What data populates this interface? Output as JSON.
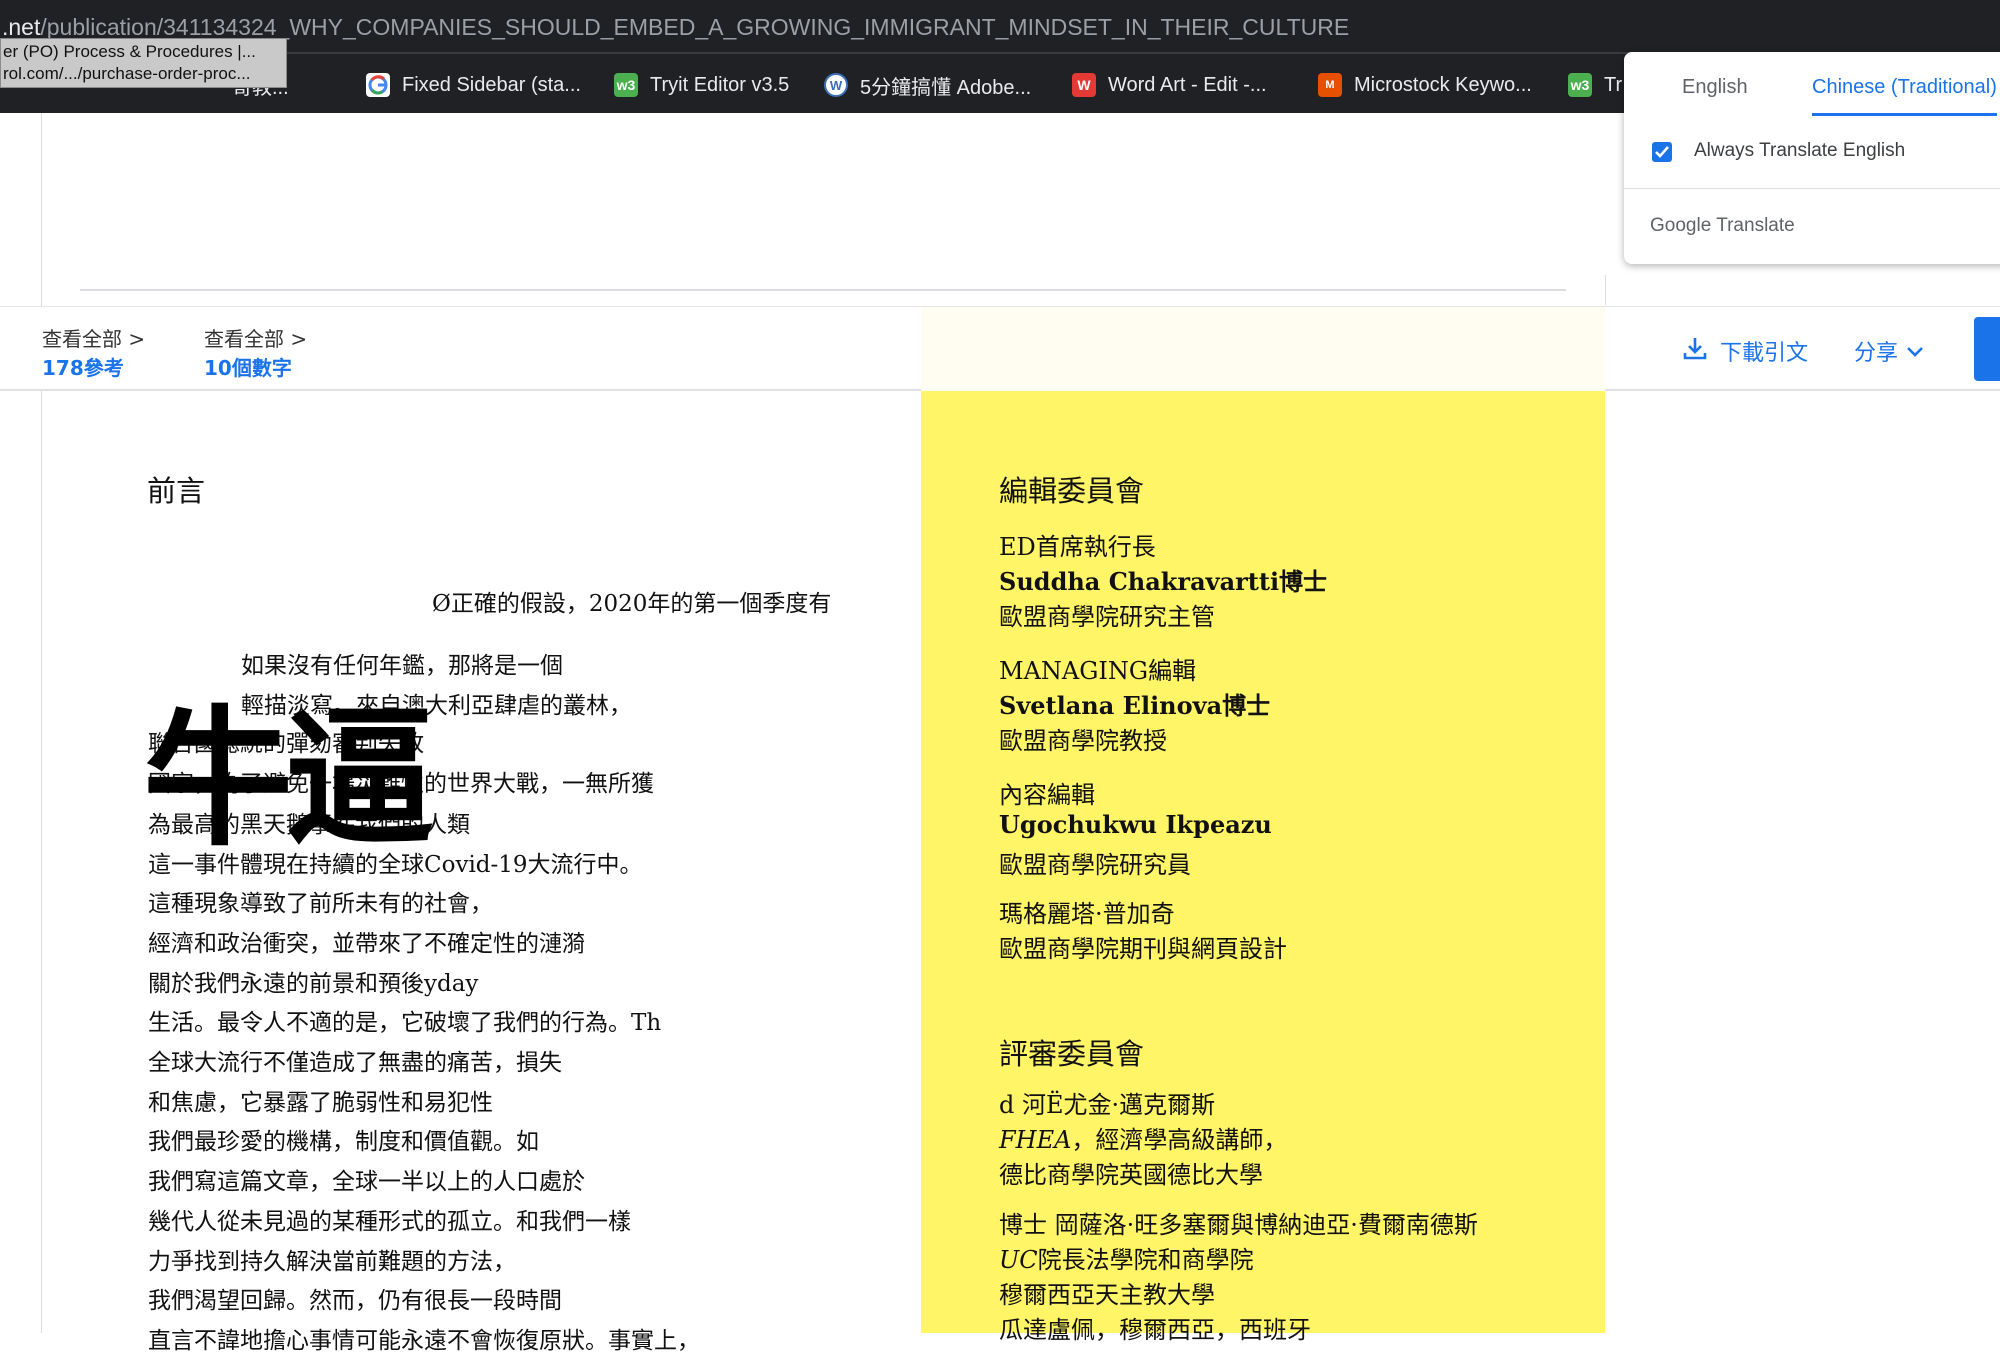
{
  "browser": {
    "url_host": ".net",
    "url_path": "/publication/341134324_WHY_COMPANIES_SHOULD_EMBED_A_GROWING_IMMIGRANT_MINDSET_IN_THEIR_CULTURE",
    "tooltip_line1": "er (PO) Process & Procedures |...",
    "tooltip_line2": "rol.com/.../purchase-order-proc...",
    "bookmarks": [
      {
        "label": "哥教...",
        "icon": "bookmark-icon",
        "color": "#c62828"
      },
      {
        "label": "Fixed Sidebar (sta...",
        "icon": "google-icon",
        "color": "#4285f4"
      },
      {
        "label": "Tryit Editor v3.5",
        "icon": "w3schools-icon",
        "color": "#4caf50"
      },
      {
        "label": "5分鐘搞懂 Adobe...",
        "icon": "wordpress-icon",
        "color": "#3b6fb6"
      },
      {
        "label": "Word Art - Edit -...",
        "icon": "wordart-icon",
        "color": "#e53935"
      },
      {
        "label": "Microstock Keywo...",
        "icon": "microstock-icon",
        "color": "#e65100"
      },
      {
        "label": "Tr",
        "icon": "w3schools-icon",
        "color": "#4caf50"
      }
    ]
  },
  "translate_popup": {
    "tab_english": "English",
    "tab_chinese": "Chinese (Traditional)",
    "always_translate": "Always Translate English",
    "brand": "Google Translate"
  },
  "stats": {
    "view_all_1": "查看全部 >",
    "references": "178參考",
    "view_all_2": "查看全部 >",
    "figures": "10個數字",
    "download": "下載引文",
    "share": "分享"
  },
  "watermark": "牛逼",
  "article": {
    "heading": "前言",
    "lines": [
      "Ø正確的假設，2020年的第一個季度有",
      "如果沒有任何年鑑，那將是一個",
      "輕描淡寫。來自澳大利亞肆虐的叢林，",
      "聯合國總統的彈劾審判失敗",
      "國家，為了避免一場災難性的世界大戰，一無所獲",
      "為最高的黑天鵝事件我們的人類",
      "這一事件體現在持續的全球Covid-19大流行中。",
      "這種現象導致了前所未有的社會，",
      "經濟和政治衝突，並帶來了不確定性的漣漪",
      "關於我們永遠的前景和預後yday",
      "生活。最令人不適的是，它破壞了我們的行為。Th",
      "全球大流行不僅造成了無盡的痛苦，損失",
      "和焦慮，它暴露了脆弱性和易犯性",
      "我們最珍愛的機構，制度和價值觀。如",
      "我們寫這篇文章，全球一半以上的人口處於",
      "幾代人從未見過的某種形式的孤立。和我們一樣",
      "力爭找到持久解決當前難題的方法，",
      "我們渴望回歸。然而，仍有很長一段時間",
      "直言不諱地擔心事情可能永遠不會恢復原狀。事實上，"
    ]
  },
  "sidebar": {
    "editorial_heading": "編輯委員會",
    "editorial": [
      {
        "role": "ED首席執行長",
        "name": "Suddha Chakravartti博士",
        "affil": "歐盟商學院研究主管"
      },
      {
        "role": "MANAGING編輯",
        "name": "Svetlana Elinova博士",
        "affil": "歐盟商學院教授"
      },
      {
        "role": "內容編輯",
        "name": "Ugochukwu Ikpeazu",
        "affil": "歐盟商學院研究員"
      },
      {
        "role": "瑪格麗塔·普加奇",
        "affil": "歐盟商學院期刊與網頁設計"
      }
    ],
    "review_heading": "評審委員會",
    "reviewers": [
      {
        "line1": "d 河Ë尤金·邁克爾斯",
        "line2_em": "FHEA",
        "line2_rest": "，經濟學高級講師，",
        "line3": "德比商學院英國德比大學"
      },
      {
        "line1": "博士 岡薩洛·旺多塞爾與博納迪亞·費爾南德斯",
        "line2_em": "UC",
        "line2_rest": "院長法學院和商學院",
        "line3": "穆爾西亞天主教大學",
        "line4": "瓜達盧佩，穆爾西亞，西班牙"
      }
    ]
  }
}
